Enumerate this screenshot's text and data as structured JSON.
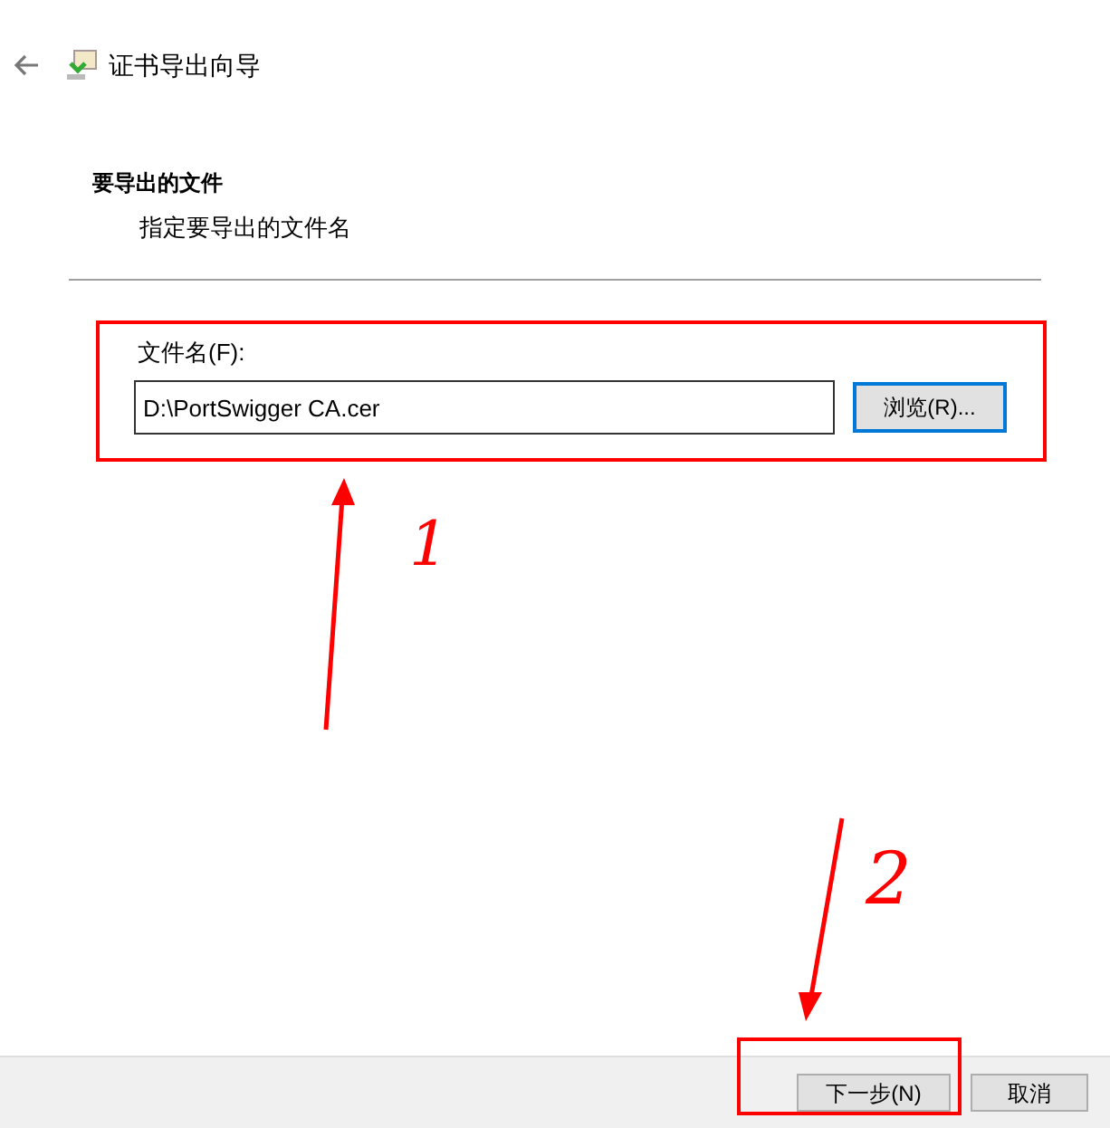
{
  "window": {
    "title": "证书导出向导"
  },
  "section": {
    "heading": "要导出的文件",
    "subtitle": "指定要导出的文件名"
  },
  "file_field": {
    "label": "文件名(F):",
    "value": "D:\\PortSwigger CA.cer"
  },
  "browse_button": "浏览(R)...",
  "buttons": [
    {
      "label": "下一步(N)"
    },
    {
      "label": "取消"
    }
  ],
  "annotations": [
    {
      "label": "1"
    },
    {
      "label": "2"
    }
  ]
}
